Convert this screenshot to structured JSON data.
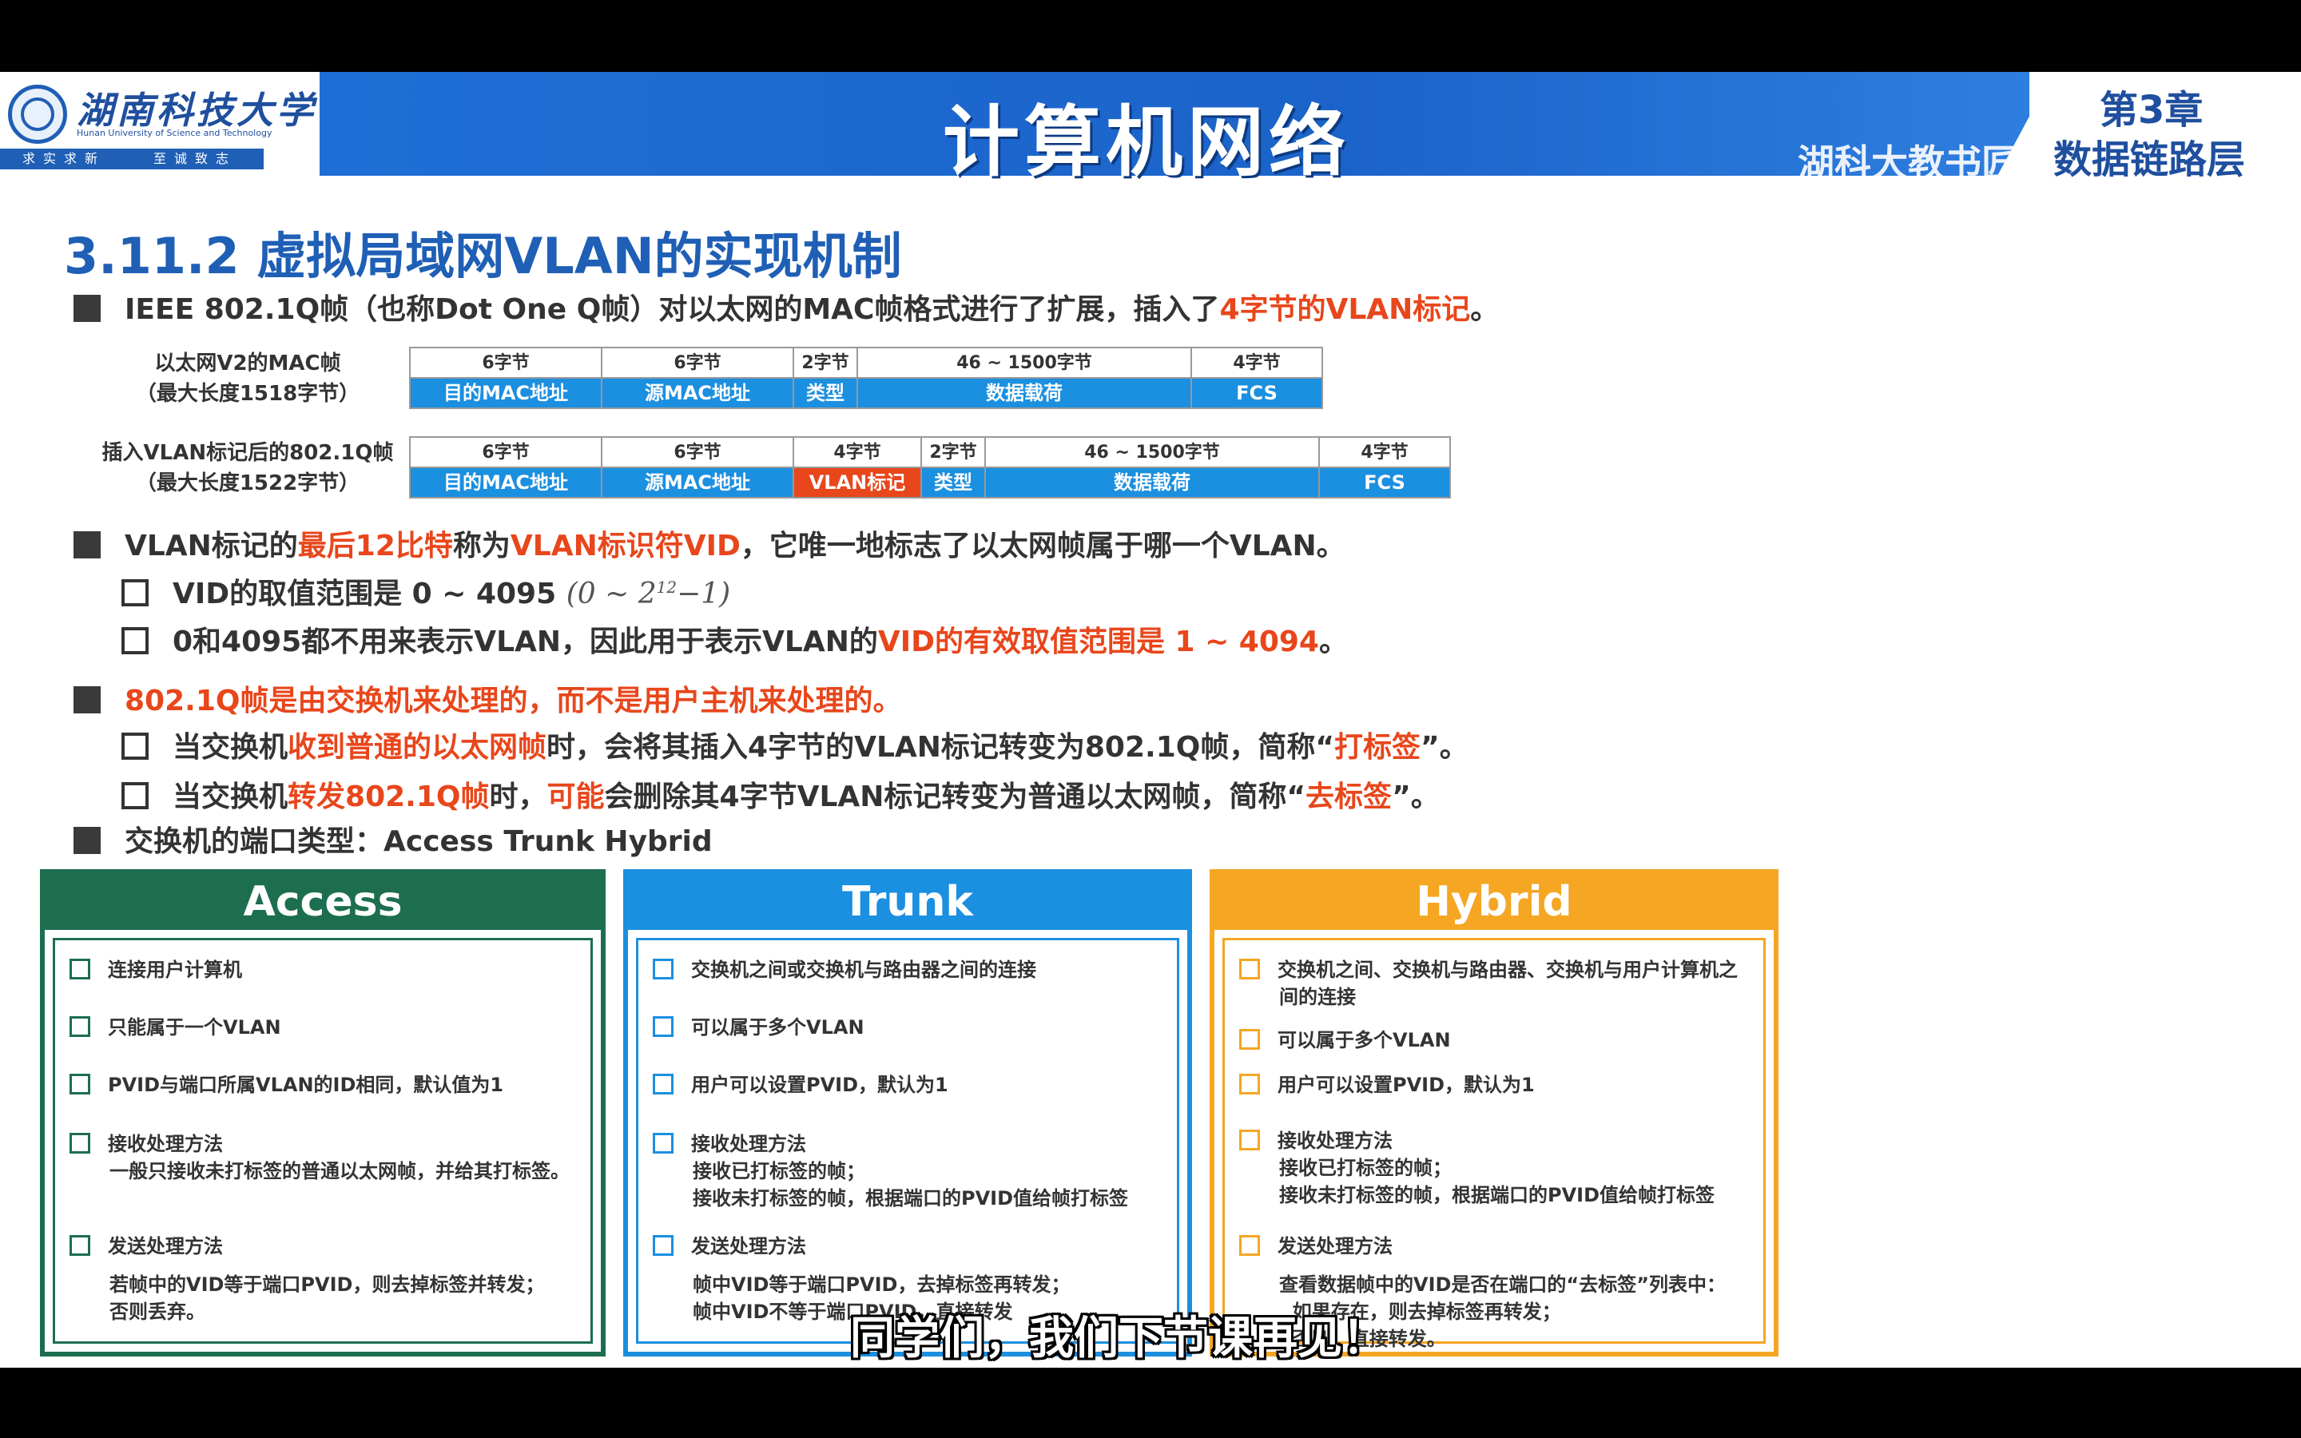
{
  "header": {
    "university_name": "湖南科技大学",
    "university_en": "Hunan University of Science and Technology",
    "motto": [
      "求实求新",
      "至诚致志"
    ],
    "course_title": "计算机网络",
    "course_sub": "湖科大教书匠",
    "chapter_title": "第3章",
    "chapter_sub": "数据链路层"
  },
  "section_title": "3.11.2 虚拟局域网VLAN的实现机制",
  "bullet1": {
    "pre": "IEEE 802.1Q帧（也称Dot One Q帧）对以太网的MAC帧格式进行了扩展，插入了",
    "hl": "4字节的VLAN标记",
    "post": "。"
  },
  "frame1": {
    "label_line1": "以太网V2的MAC帧",
    "label_line2": "（最大长度1518字节）",
    "cells": [
      {
        "size": "6字节",
        "name": "目的MAC地址"
      },
      {
        "size": "6字节",
        "name": "源MAC地址"
      },
      {
        "size": "2字节",
        "name": "类型"
      },
      {
        "size": "46 ~ 1500字节",
        "name": "数据载荷"
      },
      {
        "size": "4字节",
        "name": "FCS"
      }
    ]
  },
  "frame2": {
    "label_line1": "插入VLAN标记后的802.1Q帧",
    "label_line2": "（最大长度1522字节）",
    "cells": [
      {
        "size": "6字节",
        "name": "目的MAC地址"
      },
      {
        "size": "6字节",
        "name": "源MAC地址"
      },
      {
        "size": "4字节",
        "name": "VLAN标记"
      },
      {
        "size": "2字节",
        "name": "类型"
      },
      {
        "size": "46 ~ 1500字节",
        "name": "数据载荷"
      },
      {
        "size": "4字节",
        "name": "FCS"
      }
    ]
  },
  "bullet2": {
    "a": "VLAN标记的",
    "hl1": "最后12比特",
    "b": "称为",
    "hl2": "VLAN标识符VID",
    "c": "，它唯一地标志了以太网帧属于哪一个VLAN。",
    "sub1_text": "VID的取值范围是 0 ~ 4095",
    "sub1_formula_a": "(0 ~ 2",
    "sub1_formula_sup": "12",
    "sub1_formula_b": "−1)",
    "sub2_pre": "0和4095都不用来表示VLAN，因此用于表示VLAN的",
    "sub2_hl": "VID的有效取值范围是 1 ~ 4094",
    "sub2_post": "。"
  },
  "bullet3": {
    "hl": "802.1Q帧是由交换机来处理的，而不是用户主机来处理的。",
    "s1_a": "当交换机",
    "s1_hl": "收到普通的以太网帧",
    "s1_b": "时，会将其插入4字节的VLAN标记转变为802.1Q帧，简称“",
    "s1_hl2": "打标签",
    "s1_c": "”。",
    "s2_a": "当交换机",
    "s2_hl": "转发802.1Q帧",
    "s2_b": "时，",
    "s2_hl2": "可能",
    "s2_c": "会删除其4字节VLAN标记转变为普通以太网帧，简称“",
    "s2_hl3": "去标签",
    "s2_d": "”。"
  },
  "bullet4": "交换机的端口类型：Access  Trunk  Hybrid",
  "ports": {
    "access": {
      "title": "Access",
      "items": [
        {
          "label": "连接用户计算机",
          "sub": ""
        },
        {
          "label": "只能属于一个VLAN",
          "sub": ""
        },
        {
          "label": "PVID与端口所属VLAN的ID相同，默认值为1",
          "sub": ""
        },
        {
          "label": "接收处理方法",
          "sub": "一般只接收未打标签的普通以太网帧，并给其打标签。"
        },
        {
          "label": "发送处理方法",
          "sub": "若帧中的VID等于端口PVID，则去掉标签并转发；\n否则丢弃。"
        }
      ]
    },
    "trunk": {
      "title": "Trunk",
      "items": [
        {
          "label": "交换机之间或交换机与路由器之间的连接",
          "sub": ""
        },
        {
          "label": "可以属于多个VLAN",
          "sub": ""
        },
        {
          "label": "用户可以设置PVID，默认为1",
          "sub": ""
        },
        {
          "label": "接收处理方法",
          "sub": "接收已打标签的帧；\n接收未打标签的帧，根据端口的PVID值给帧打标签"
        },
        {
          "label": "发送处理方法",
          "sub": "帧中VID等于端口PVID，去掉标签再转发；\n帧中VID不等于端口PVID，直接转发"
        }
      ]
    },
    "hybrid": {
      "title": "Hybrid",
      "items": [
        {
          "label": "交换机之间、交换机与路由器、交换机与用户计算机之间的连接",
          "sub": ""
        },
        {
          "label": "可以属于多个VLAN",
          "sub": ""
        },
        {
          "label": "用户可以设置PVID，默认为1",
          "sub": ""
        },
        {
          "label": "接收处理方法",
          "sub": "接收已打标签的帧；\n接收未打标签的帧，根据端口的PVID值给帧打标签"
        },
        {
          "label": "发送处理方法",
          "sub": "查看数据帧中的VID是否在端口的“去标签”列表中：\n  如果存在，则去掉标签再转发；\n  否则，直接转发。"
        }
      ]
    }
  },
  "caption": "同学们，我们下节课再见！",
  "colors": {
    "accent_blue": "#1f5fb5",
    "highlight_orange": "#e8461b",
    "access_green": "#1d6e4f",
    "trunk_blue": "#1b8fe0",
    "hybrid_orange": "#f5a623"
  }
}
